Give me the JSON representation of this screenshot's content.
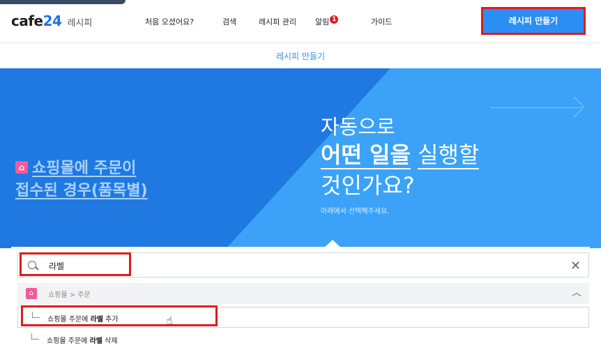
{
  "header": {
    "logo_main": "cafe",
    "logo_num": "24",
    "logo_sub": "레시피",
    "nav": [
      {
        "label": "처음 오셨어요?"
      },
      {
        "label": "검색"
      },
      {
        "label": "레시피 관리"
      },
      {
        "label": "알림",
        "badge": "1"
      },
      {
        "label": "가이드"
      }
    ],
    "create_button": "레시피 만들기"
  },
  "subheader": {
    "title": "레시피 만들기"
  },
  "hero": {
    "trigger_line1": "쇼핑몰에 주문이",
    "trigger_line2": "접수된 경우(품목별)",
    "q_line1": "자동으로",
    "q_line2_bold": "어떤 일을",
    "q_line2_rest": "실행할",
    "q_line3": "것인가요?",
    "hint": "아래에서 선택해주세요."
  },
  "search": {
    "value": "라벨"
  },
  "results": {
    "category": "쇼핑몰 > 주문",
    "items": [
      {
        "prefix": "쇼핑몰 주문에 ",
        "bold": "라벨",
        "suffix": " 추가"
      },
      {
        "prefix": "쇼핑몰 주문에 ",
        "bold": "라벨",
        "suffix": " 삭제"
      }
    ]
  },
  "colors": {
    "accent": "#2b8ff5",
    "hero_dark": "#1f79e0",
    "hero_light": "#3ba2f7",
    "highlight_red": "#e01b1b",
    "shop_pink": "#f15b9b"
  },
  "icons": [
    "search-icon",
    "close-icon",
    "chevron-up-icon",
    "shop-cart-icon",
    "arrow-right-icon",
    "hand-cursor-icon"
  ]
}
